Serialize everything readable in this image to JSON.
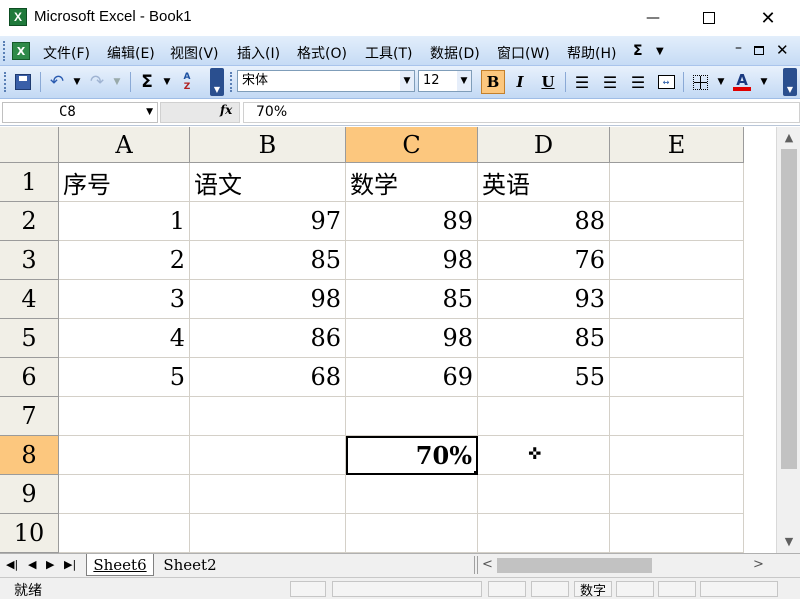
{
  "window": {
    "title": "Microsoft Excel - Book1"
  },
  "menu": {
    "items": [
      "文件(F)",
      "编辑(E)",
      "视图(V)",
      "插入(I)",
      "格式(O)",
      "工具(T)",
      "数据(D)",
      "窗口(W)",
      "帮助(H)"
    ]
  },
  "toolbar": {
    "font_name": "宋体",
    "font_size": "12",
    "bold": "B",
    "italic": "I",
    "underline": "U",
    "font_color_glyph": "A",
    "sum_glyph": "Σ",
    "menu_sum_glyph": "Σ"
  },
  "formula_bar": {
    "name_box": "C8",
    "fx": "fx",
    "content": "70%"
  },
  "grid": {
    "columns": [
      "A",
      "B",
      "C",
      "D",
      "E"
    ],
    "rows": [
      "1",
      "2",
      "3",
      "4",
      "5",
      "6",
      "7",
      "8",
      "9",
      "10"
    ],
    "cells": {
      "A1": "序号",
      "B1": "语文",
      "C1": "数学",
      "D1": "英语",
      "A2": "1",
      "B2": "97",
      "C2": "89",
      "D2": "88",
      "A3": "2",
      "B3": "85",
      "C3": "98",
      "D3": "76",
      "A4": "3",
      "B4": "98",
      "C4": "85",
      "D4": "93",
      "A5": "4",
      "B5": "86",
      "C5": "98",
      "D5": "85",
      "A6": "5",
      "B6": "68",
      "C6": "69",
      "D6": "55",
      "C8": "70%"
    },
    "active_cell": "C8",
    "selected_column": "C",
    "selected_row": "8"
  },
  "sheets": {
    "tabs": [
      "Sheet6",
      "Sheet2"
    ]
  },
  "status": {
    "ready": "就绪",
    "num_indicator": "数字"
  },
  "colors": {
    "selection_header": "#fcc77e",
    "menu_bar": "#c6dbf5",
    "grid_line": "#d4d0c8"
  }
}
